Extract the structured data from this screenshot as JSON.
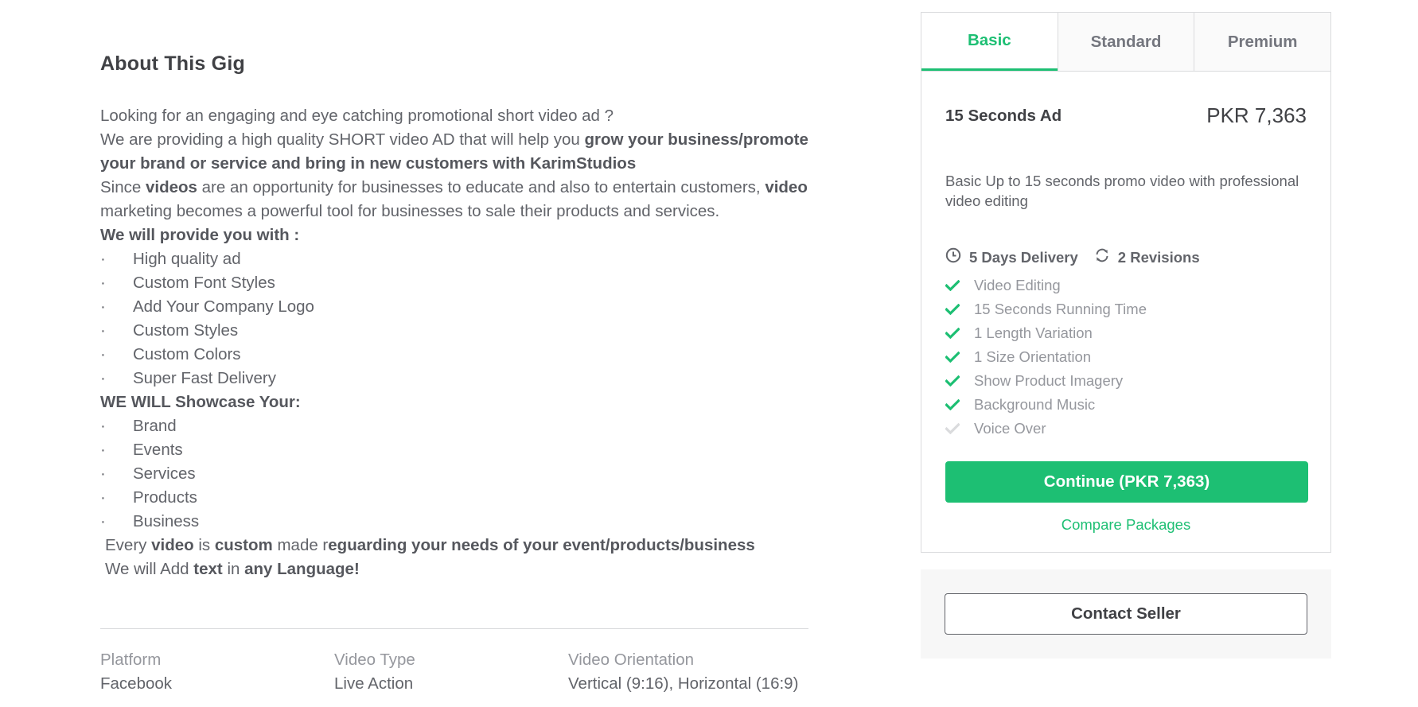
{
  "about": {
    "title": "About This Gig",
    "line1": "Looking for an engaging and eye catching promotional short video ad ?",
    "line2a": "We are providing a high quality SHORT video AD that will help you ",
    "line2b": "grow your business/promote your brand or service and bring in new customers with KarimStudios",
    "line3a": "Since ",
    "line3b": "videos",
    "line3c": " are an opportunity for businesses to educate and also to entertain customers, ",
    "line3d": "video",
    "line3e": " marketing becomes a powerful tool for businesses to sale their products and services.",
    "provide_header": "We will provide you with :",
    "provide_items": [
      "High quality ad",
      "Custom Font Styles",
      "Add Your Company Logo",
      "Custom Styles",
      "Custom Colors",
      "Super Fast Delivery"
    ],
    "showcase_header": "WE WILL Showcase Your:",
    "showcase_items": [
      "Brand",
      "Events",
      "Services",
      "Products",
      "Business"
    ],
    "bullet": "·",
    "closing1": {
      "a": "Every ",
      "b": "video",
      "c": " is ",
      "d": "custom",
      "e": " made r",
      "f": "eguarding your needs of your event/products/business"
    },
    "closing2": {
      "a": "We will Add ",
      "b": "text",
      "c": " in ",
      "d": "any Language!"
    }
  },
  "meta": [
    {
      "label": "Platform",
      "value": "Facebook"
    },
    {
      "label": "Video Type",
      "value": "Live Action"
    },
    {
      "label": "Video Orientation",
      "value": "Vertical (9:16), Horizontal (16:9)"
    }
  ],
  "package": {
    "tabs": [
      {
        "label": "Basic",
        "active": true
      },
      {
        "label": "Standard",
        "active": false
      },
      {
        "label": "Premium",
        "active": false
      }
    ],
    "title": "15 Seconds Ad",
    "price": "PKR 7,363",
    "description": "Basic Up to 15 seconds promo video with professional video editing",
    "delivery": "5 Days Delivery",
    "revisions": "2 Revisions",
    "features": [
      {
        "label": "Video Editing",
        "included": true
      },
      {
        "label": "15 Seconds Running Time",
        "included": true
      },
      {
        "label": "1 Length Variation",
        "included": true
      },
      {
        "label": "1 Size Orientation",
        "included": true
      },
      {
        "label": "Show Product Imagery",
        "included": true
      },
      {
        "label": "Background Music",
        "included": true
      },
      {
        "label": "Voice Over",
        "included": false
      }
    ],
    "continue_label": "Continue (PKR 7,363)",
    "compare_label": "Compare Packages"
  },
  "contact": {
    "label": "Contact Seller"
  },
  "colors": {
    "accent": "#1dbf73",
    "included_check": "#1dbf73",
    "excluded_check": "#dadbdd"
  },
  "icons": {
    "delivery": "clock-icon",
    "revisions": "refresh-icon",
    "feature": "check-icon"
  }
}
